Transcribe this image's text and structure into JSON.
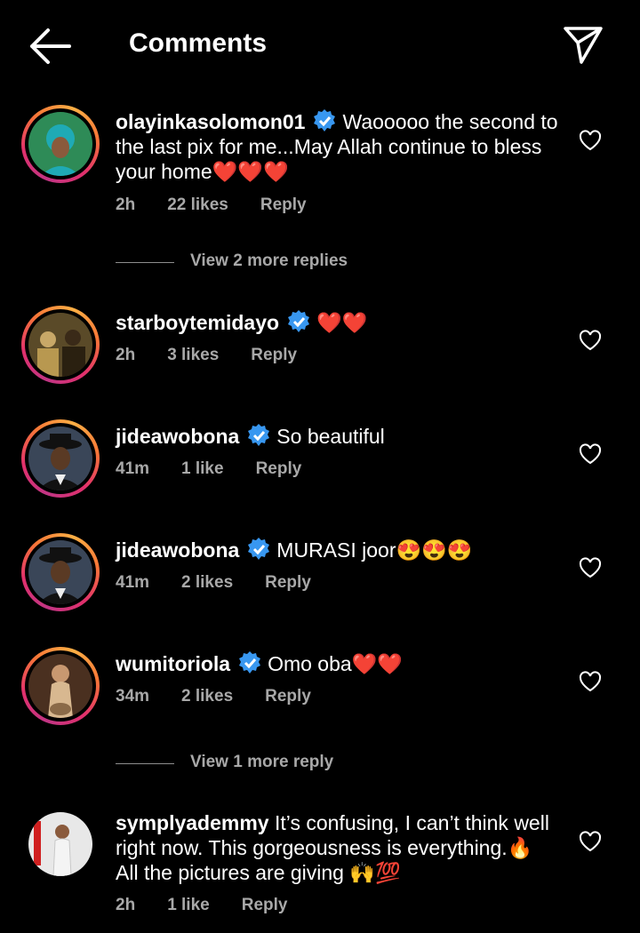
{
  "header": {
    "title": "Comments",
    "back_icon": "arrow-left-icon",
    "send_icon": "paper-plane-icon"
  },
  "comments": [
    {
      "username": "olayinkasolomon01",
      "verified": true,
      "text": "Waooooo the second to the last pix for me...May Allah continue to bless your home❤️❤️❤️",
      "time": "2h",
      "likes": "22 likes",
      "reply": "Reply"
    },
    {
      "username": "starboytemidayo",
      "verified": true,
      "text": "❤️❤️",
      "time": "2h",
      "likes": "3 likes",
      "reply": "Reply"
    },
    {
      "username": "jideawobona",
      "verified": true,
      "text": "So beautiful",
      "time": "41m",
      "likes": "1 like",
      "reply": "Reply"
    },
    {
      "username": "jideawobona",
      "verified": true,
      "text": "MURASI joor😍😍😍",
      "time": "41m",
      "likes": "2 likes",
      "reply": "Reply"
    },
    {
      "username": "wumitoriola",
      "verified": true,
      "text": "Omo oba❤️❤️",
      "time": "34m",
      "likes": "2 likes",
      "reply": "Reply"
    },
    {
      "username": "symplyademmy",
      "verified": false,
      "text": "It’s confusing, I can’t think well right now. This gorgeousness is everything.🔥 All the pictures are giving 🙌💯",
      "time": "2h",
      "likes": "1 like",
      "reply": "Reply"
    }
  ],
  "view_more": [
    {
      "label": "View 2 more replies"
    },
    {
      "label": "View 1 more reply"
    }
  ],
  "colors": {
    "background": "#000000",
    "meta": "#a8a8a8",
    "verified": "#3897f0",
    "story_ring": "#e1306c"
  }
}
